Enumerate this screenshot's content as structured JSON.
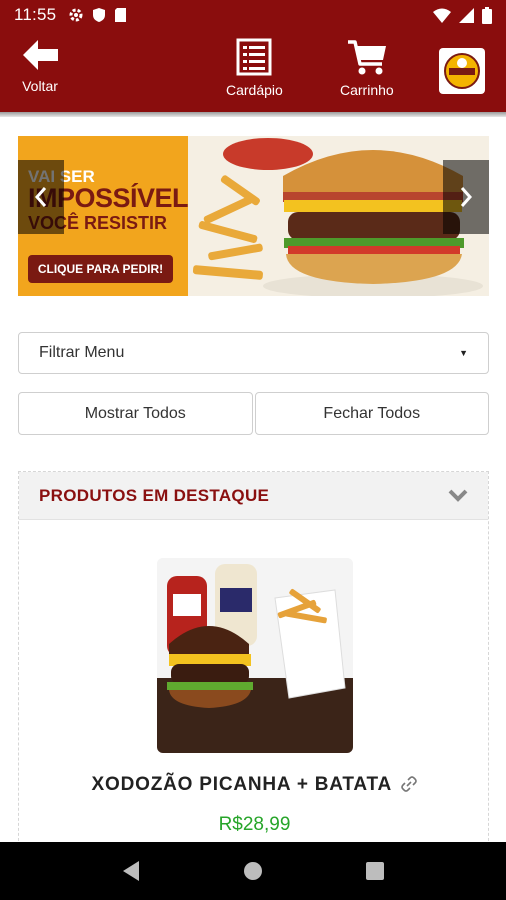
{
  "status_bar": {
    "time": "11:55"
  },
  "app_bar": {
    "back_label": "Voltar",
    "menu_label": "Cardápio",
    "cart_label": "Carrinho",
    "logo_icon": "store-logo-icon"
  },
  "banner": {
    "line1": "VAI SER",
    "line2": "IMPOSSÍVEL",
    "line3": "VOCÊ RESISTIR",
    "cta": "CLIQUE PARA PEDIR!"
  },
  "filter": {
    "label": "Filtrar Menu"
  },
  "buttons": {
    "show_all": "Mostrar Todos",
    "close_all": "Fechar Todos"
  },
  "section": {
    "title": "PRODUTOS EM DESTAQUE",
    "product": {
      "name": "XODOZÃO PICANHA + BATATA",
      "price": "R$28,99"
    }
  },
  "colors": {
    "brand": "#8a0d0d",
    "price": "#27a52a",
    "banner": "#f2a51d"
  }
}
